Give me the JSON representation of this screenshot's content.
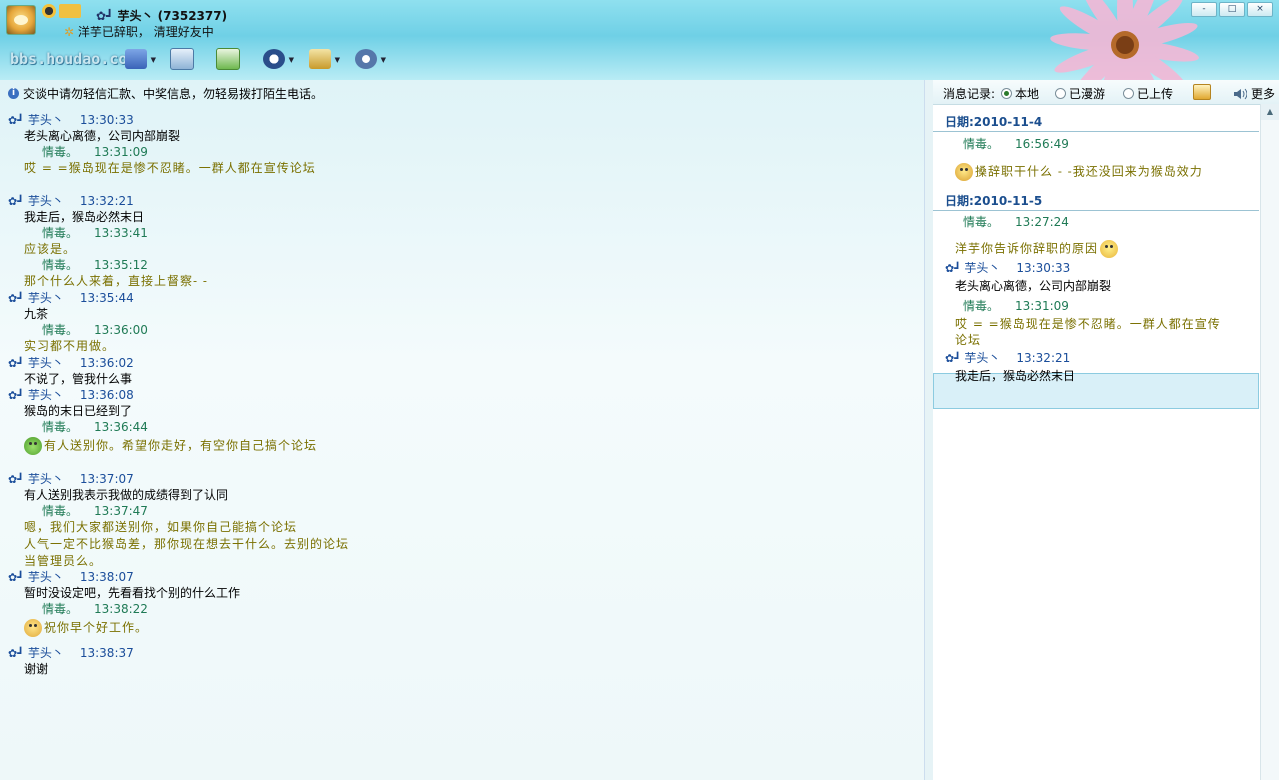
{
  "header": {
    "contact_name": "芋头丶",
    "contact_id": "(7352377)",
    "signature": "洋芋已辞职，  清理好友中",
    "watermark": "bbs.houdao.com",
    "window_buttons": [
      "-",
      "□",
      "×"
    ]
  },
  "toolbar": {
    "buttons": [
      {
        "name": "video-chat",
        "icon": "video-icon"
      },
      {
        "name": "send-email",
        "icon": "mail-icon"
      },
      {
        "name": "add-friend",
        "icon": "add-contact-icon"
      },
      {
        "name": "qq-helper",
        "icon": "penguin-icon"
      },
      {
        "name": "app-menu",
        "icon": "spade-icon"
      },
      {
        "name": "settings",
        "icon": "gear-icon"
      }
    ]
  },
  "chat": {
    "notice": "交谈中请勿轻信汇款、中奖信息，勿轻易拨打陌生电话。",
    "messages": [
      {
        "sender": "芋头丶",
        "time": "13:30:33",
        "text": "老头离心离德，公司内部崩裂",
        "self": false
      },
      {
        "sender": "情毒。",
        "time": "13:31:09",
        "text": "哎 = =猴岛现在是惨不忍睹。一群人都在宣传论坛",
        "self": true
      },
      {
        "sender": "芋头丶",
        "time": "13:32:21",
        "text": "我走后，猴岛必然末日",
        "self": false
      },
      {
        "sender": "情毒。",
        "time": "13:33:41",
        "text": "应该是。",
        "self": true
      },
      {
        "sender": "情毒。",
        "time": "13:35:12",
        "text": "那个什么人来着，直接上督察- -",
        "self": true
      },
      {
        "sender": "芋头丶",
        "time": "13:35:44",
        "text": "九茶",
        "self": false
      },
      {
        "sender": "情毒。",
        "time": "13:36:00",
        "text": "实习都不用做。",
        "self": true
      },
      {
        "sender": "芋头丶",
        "time": "13:36:02",
        "text": "不说了，管我什么事",
        "self": false
      },
      {
        "sender": "芋头丶",
        "time": "13:36:08",
        "text": "猴岛的末日已经到了",
        "self": false
      },
      {
        "sender": "情毒。",
        "time": "13:36:44",
        "text": "有人送别你。希望你走好，有空你自己搞个论坛",
        "self": true
      },
      {
        "sender": "芋头丶",
        "time": "13:37:07",
        "text": "有人送别我表示我做的成绩得到了认同",
        "self": false
      },
      {
        "sender": "情毒。",
        "time": "13:37:47",
        "text": [
          "嗯，我们大家都送别你，如果你自己能搞个论坛",
          "人气一定不比猴岛差，那你现在想去干什么。去别的论坛",
          "当管理员么。"
        ],
        "self": true
      },
      {
        "sender": "芋头丶",
        "time": "13:38:07",
        "text": "暂时没设定吧，先看看找个别的什么工作",
        "self": false
      },
      {
        "sender": "情毒。",
        "time": "13:38:22",
        "text": "祝你早个好工作。",
        "self": true
      },
      {
        "sender": "芋头丶",
        "time": "13:38:37",
        "text": "谢谢",
        "self": false
      }
    ]
  },
  "history": {
    "label": "消息记录:",
    "options": [
      "本地",
      "已漫游",
      "已上传"
    ],
    "selected": "本地",
    "more_label": "更多",
    "dates": [
      "日期:2010-11-4",
      "日期:2010-11-5"
    ],
    "entries": [
      {
        "sender": "情毒。",
        "time": "16:56:49",
        "text": "搡辞职干什么 - -我还没回来为猴岛效力"
      },
      {
        "sender": "情毒。",
        "time": "13:27:24",
        "text": "洋芋你告诉你辞职的原因"
      },
      {
        "sender": "芋头丶",
        "time": "13:30:33",
        "text": "老头离心离德，公司内部崩裂"
      },
      {
        "sender": "情毒。",
        "time": "13:31:09",
        "text": [
          "哎 = =猴岛现在是惨不忍睹。一群人都在宣传",
          "论坛"
        ]
      },
      {
        "sender": "芋头丶",
        "time": "13:32:21",
        "text": "我走后，猴岛必然末日"
      }
    ]
  },
  "colors": {
    "header_bg": "#7fd8ec",
    "self_name": "#1f7a55",
    "other_name": "#1a4d9a",
    "self_text": "#7a7000",
    "date_text": "#1b4e8e",
    "selected_row": "#d9f0f8"
  }
}
